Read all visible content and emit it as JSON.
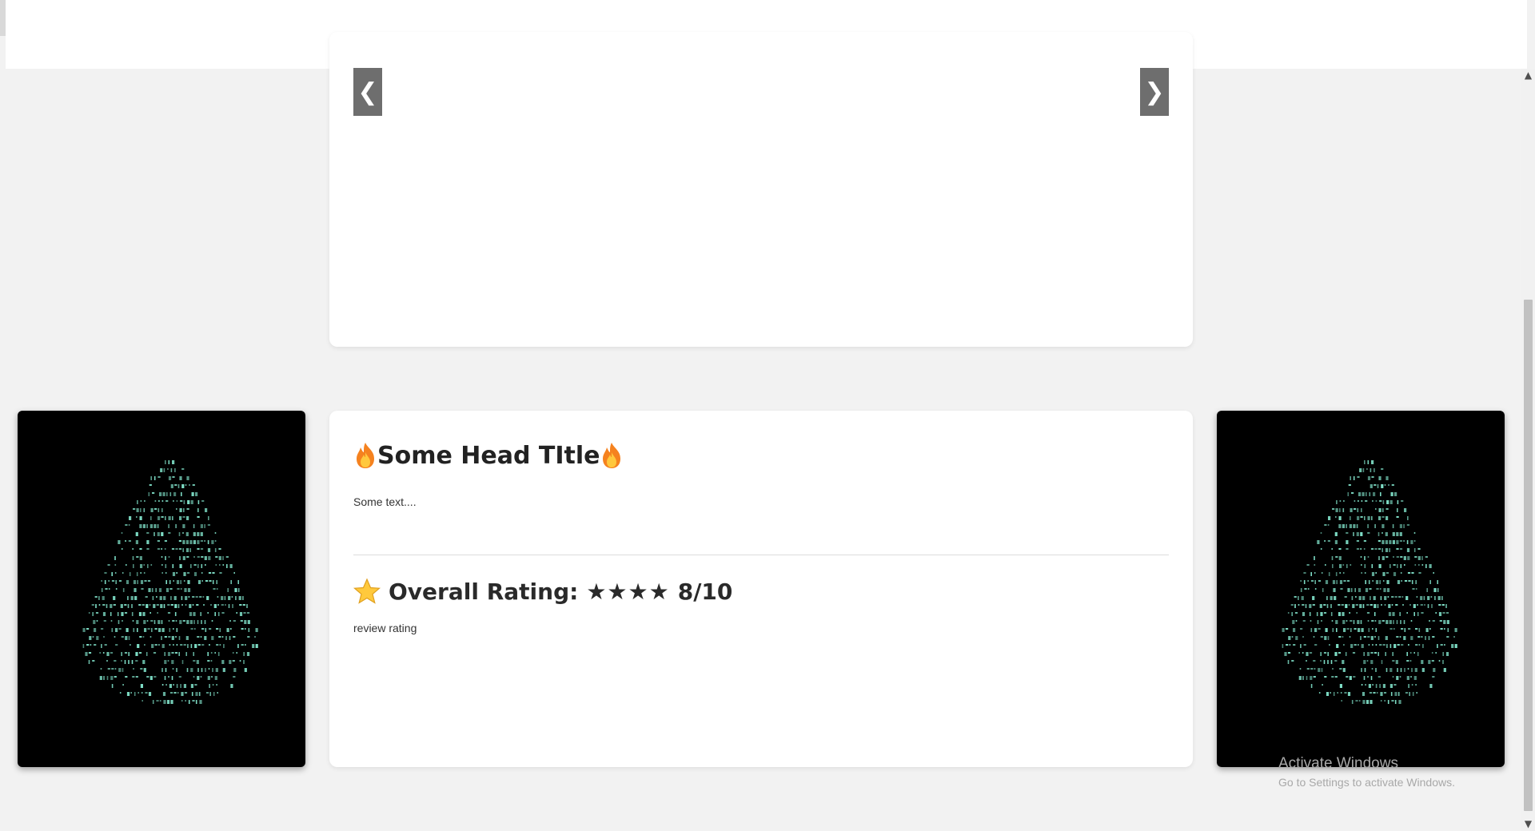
{
  "carousel": {
    "prev_label": "❮",
    "next_label": "❯"
  },
  "review": {
    "title": "Some Head TItle",
    "text": "Some text....",
    "rating_label": "Overall Rating:",
    "rating_stars": "★★★★",
    "rating_value": "8/10",
    "rating_text": "review rating"
  },
  "side_images": {
    "icon": "ascii-art-droplet",
    "accent_color": "#7fe0c8"
  },
  "watermark": {
    "title": "Activate Windows",
    "subtitle": "Go to Settings to activate Windows."
  },
  "colors": {
    "background": "#f2f2f2",
    "card": "#ffffff",
    "carousel_button": "#6e6e6e",
    "art_background": "#000000"
  }
}
